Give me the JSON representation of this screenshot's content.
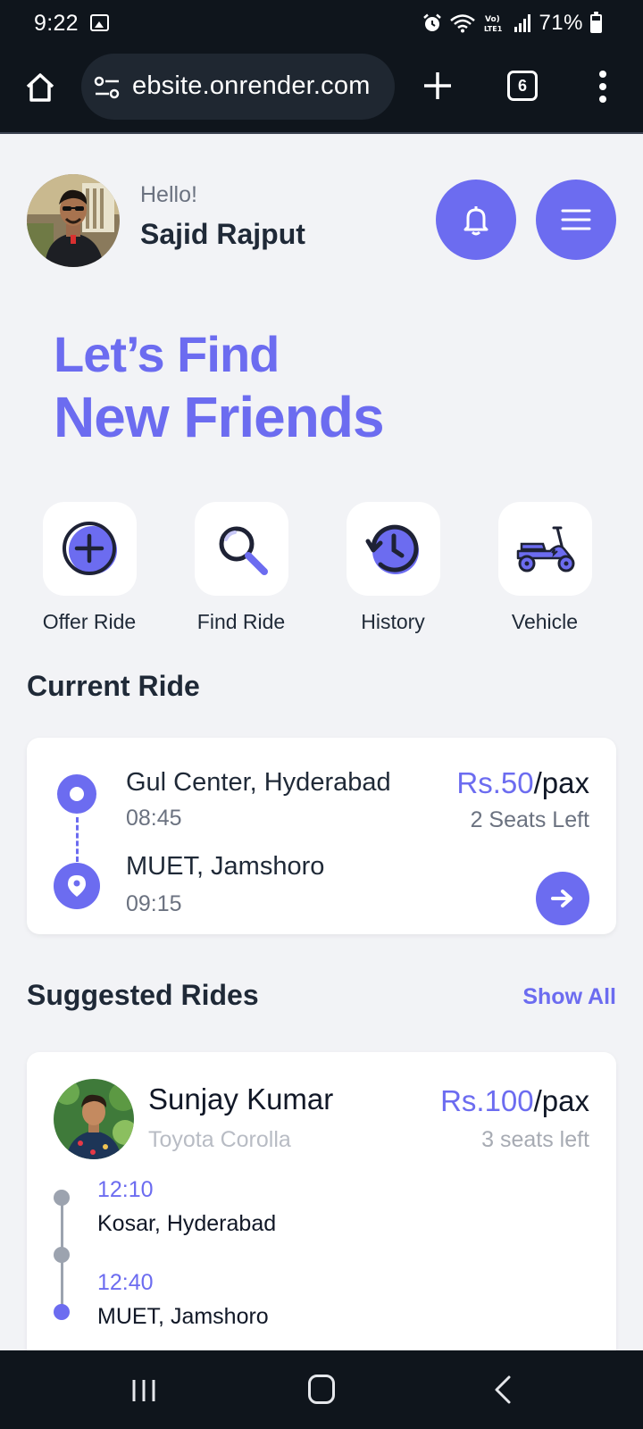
{
  "status_bar": {
    "time": "9:22",
    "battery": "71%"
  },
  "browser": {
    "url": "ebsite.onrender.com",
    "tab_count": "6"
  },
  "header": {
    "greeting": "Hello!",
    "user_name": "Sajid Rajput"
  },
  "hero": {
    "line1": "Let’s Find",
    "line2": "New Friends"
  },
  "actions": [
    {
      "label": "Offer Ride",
      "icon": "plus-circle-icon"
    },
    {
      "label": "Find Ride",
      "icon": "search-icon"
    },
    {
      "label": "History",
      "icon": "history-icon"
    },
    {
      "label": "Vehicle",
      "icon": "scooter-icon"
    }
  ],
  "current_ride": {
    "title": "Current Ride",
    "from_place": "Gul Center, Hyderabad",
    "from_time": "08:45",
    "to_place": "MUET, Jamshoro",
    "to_time": "09:15",
    "price_amount": "Rs.50",
    "price_unit": "/pax",
    "seats_left": "2 Seats Left"
  },
  "suggested": {
    "title": "Suggested Rides",
    "show_all": "Show All",
    "rides": [
      {
        "driver": "Sunjay Kumar",
        "car": "Toyota Corolla",
        "price_amount": "Rs.100",
        "price_unit": "/pax",
        "seats_left": "3 seats left",
        "stops": [
          {
            "time": "12:10",
            "place": "Kosar, Hyderabad"
          },
          {
            "time": "12:40",
            "place": "MUET, Jamshoro"
          }
        ]
      }
    ]
  },
  "colors": {
    "accent": "#6c6cf0",
    "background": "#f2f3f6",
    "system_bar": "#0f151c"
  }
}
